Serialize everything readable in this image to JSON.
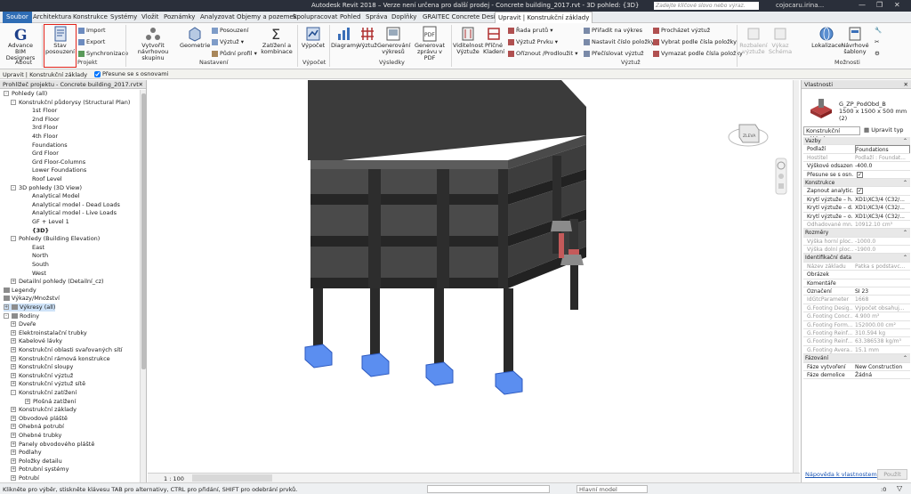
{
  "app": {
    "title": "Autodesk Revit 2018 – Verze není určena pro další prodej -  Concrete building_2017.rvt - 3D pohled: {3D}",
    "search_placeholder": "Zadejte klíčové slovo nebo výraz.",
    "user": "cojocaru.irina..."
  },
  "menu_tabs": [
    "Soubor",
    "Architektura",
    "Konstrukce",
    "Systémy",
    "Vložit",
    "Poznámky",
    "Analyzovat",
    "Objemy a pozemek",
    "Spolupracovat",
    "Pohled",
    "Správa",
    "Doplňky",
    "GRAITEC Concrete Design",
    "Upravit | Konstrukční základy"
  ],
  "ribbon": {
    "about_btn": "Advance BIM Designers",
    "stav_btn": "Stav posouzení",
    "project_small": [
      "Import",
      "Export",
      "Synchronizace"
    ],
    "vytvorit_btn": "Vytvořit návrhovou skupinu",
    "geometrie_btn": "Geometrie",
    "nastaveni_small": [
      "Posouzení",
      "Výztuž",
      "Půdní profil"
    ],
    "zatizeni_btn": "Zatížení a kombinace",
    "vypocet_btn": "Výpočet",
    "vysledky_btns": [
      "Diagramy",
      "Výztuž",
      "Generování výkresů",
      "Generovat zprávu v PDF"
    ],
    "vyztuz_btns": [
      "Viditelnost Výztuže",
      "Příčné Kladení"
    ],
    "vyztuz_small1": [
      "Řada prutů",
      "Výztuž Prvku",
      "Oříznout /Prodloužit"
    ],
    "vyztuz_small2": [
      "Přiřadit na výkres",
      "Nastavit číslo položky",
      "Přečíslovat výztuž"
    ],
    "vyztuz_small3": [
      "Procházet výztuž",
      "Vybrat podle čísla položky",
      "Vymazat podle čísla položky"
    ],
    "moznosti_btns": [
      "Rozbalení výztuže",
      "Výkaz Schéma",
      "Lokalizace",
      "Návrhové šablony"
    ],
    "groups": [
      "About",
      "Projekt",
      "Nastavení",
      "Výpočet",
      "Výsledky",
      "Výztuž",
      "Možnosti"
    ]
  },
  "options_bar": {
    "context": "Upravit | Konstrukční základy",
    "checkbox_label": "Přesune se s osnovami",
    "checked": true
  },
  "browser": {
    "title": "Prohlížeč projektu - Concrete building_2017.rvt",
    "items": [
      {
        "t": "Pohledy (all)",
        "lvl": 0,
        "tg": "-"
      },
      {
        "t": "Konstrukční půdorysy (Structural Plan)",
        "lvl": 1,
        "tg": "-"
      },
      {
        "t": "1st Floor",
        "lvl": 3
      },
      {
        "t": "2nd Floor",
        "lvl": 3
      },
      {
        "t": "3rd Floor",
        "lvl": 3
      },
      {
        "t": "4th Floor",
        "lvl": 3
      },
      {
        "t": "Foundations",
        "lvl": 3
      },
      {
        "t": "Grd Floor",
        "lvl": 3
      },
      {
        "t": "Grd Floor-Columns",
        "lvl": 3
      },
      {
        "t": "Lower Foundations",
        "lvl": 3
      },
      {
        "t": "Roof Level",
        "lvl": 3
      },
      {
        "t": "3D pohledy (3D View)",
        "lvl": 1,
        "tg": "-"
      },
      {
        "t": "Analytical Model",
        "lvl": 3
      },
      {
        "t": "Analytical model - Dead Loads",
        "lvl": 3
      },
      {
        "t": "Analytical model - Live Loads",
        "lvl": 3
      },
      {
        "t": "GF + Level 1",
        "lvl": 3
      },
      {
        "t": "{3D}",
        "lvl": 3,
        "bold": true
      },
      {
        "t": "Pohledy (Building Elevation)",
        "lvl": 1,
        "tg": "-"
      },
      {
        "t": "East",
        "lvl": 3
      },
      {
        "t": "North",
        "lvl": 3
      },
      {
        "t": "South",
        "lvl": 3
      },
      {
        "t": "West",
        "lvl": 3
      },
      {
        "t": "Detailní pohledy (Detailní_cz)",
        "lvl": 1,
        "tg": "+"
      },
      {
        "t": "Legendy",
        "lvl": 0,
        "icon": true
      },
      {
        "t": "Výkazy/Množství",
        "lvl": 0,
        "icon": true
      },
      {
        "t": "Výkresy (all)",
        "lvl": 0,
        "tg": "+",
        "icon": true,
        "sel": true
      },
      {
        "t": "Rodiny",
        "lvl": 0,
        "tg": "-",
        "icon": true
      },
      {
        "t": "Dveře",
        "lvl": 1,
        "tg": "+"
      },
      {
        "t": "Elektroinstalační trubky",
        "lvl": 1,
        "tg": "+"
      },
      {
        "t": "Kabelové lávky",
        "lvl": 1,
        "tg": "+"
      },
      {
        "t": "Konstrukční oblasti svařovaných sítí",
        "lvl": 1,
        "tg": "+"
      },
      {
        "t": "Konstrukční rámová konstrukce",
        "lvl": 1,
        "tg": "+"
      },
      {
        "t": "Konstrukční sloupy",
        "lvl": 1,
        "tg": "+"
      },
      {
        "t": "Konstrukční výztuž",
        "lvl": 1,
        "tg": "+"
      },
      {
        "t": "Konstrukční výztuž sítě",
        "lvl": 1,
        "tg": "+"
      },
      {
        "t": "Konstrukční zatížení",
        "lvl": 1,
        "tg": "-"
      },
      {
        "t": "Plošná zatížení",
        "lvl": 2,
        "tg": "+"
      },
      {
        "t": "Konstrukční základy",
        "lvl": 1,
        "tg": "+"
      },
      {
        "t": "Obvodové pláště",
        "lvl": 1,
        "tg": "+"
      },
      {
        "t": "Ohebná potrubí",
        "lvl": 1,
        "tg": "+"
      },
      {
        "t": "Ohebné trubky",
        "lvl": 1,
        "tg": "+"
      },
      {
        "t": "Panely obvodového pláště",
        "lvl": 1,
        "tg": "+"
      },
      {
        "t": "Podlahy",
        "lvl": 1,
        "tg": "+"
      },
      {
        "t": "Položky detailu",
        "lvl": 1,
        "tg": "+"
      },
      {
        "t": "Potrubní systémy",
        "lvl": 1,
        "tg": "+"
      },
      {
        "t": "Potrubí",
        "lvl": 1,
        "tg": "+"
      }
    ]
  },
  "viewport": {
    "scale": "1 : 100",
    "viewcube_label": "ZLEVA"
  },
  "props": {
    "title": "Vlastnosti",
    "type_name": "G_ZP_PodObd_B",
    "type_size": "1500 x 1500 x 500 mm (2)",
    "selector": "Konstrukční základy",
    "edit_type": "Upravit typ",
    "rows": [
      {
        "sec": "Vazby"
      },
      {
        "k": "Podlaží",
        "v": "Foundations"
      },
      {
        "k": "Hostitel",
        "v": "Podlaží : Foundat...",
        "dim": true
      },
      {
        "k": "Výškové odsazen...",
        "v": "-400.0"
      },
      {
        "k": "Přesune se s osn...",
        "chk": true
      },
      {
        "sec": "Konstrukce"
      },
      {
        "k": "Zapnout analytic...",
        "chk": true
      },
      {
        "k": "Krytí výztuže – h...",
        "v": "XD1\\XC3/4 (C32/..."
      },
      {
        "k": "Krytí výztuže – d...",
        "v": "XD1\\XC3/4 (C32/..."
      },
      {
        "k": "Krytí výztuže – o...",
        "v": "XD1\\XC3/4 (C32/..."
      },
      {
        "k": "Odhadované mn...",
        "v": "10912.10 cm³",
        "dim": true
      },
      {
        "sec": "Rozměry"
      },
      {
        "k": "Výška horní ploc...",
        "v": "-1000.0",
        "dim": true
      },
      {
        "k": "Výška dolní ploc...",
        "v": "-1900.0",
        "dim": true
      },
      {
        "sec": "Identifikační data"
      },
      {
        "k": "Název základu",
        "v": "Patka s podstavc...",
        "dim": true
      },
      {
        "k": "Obrázek",
        "v": ""
      },
      {
        "k": "Komentáře",
        "v": ""
      },
      {
        "k": "Označení",
        "v": "SI 23"
      },
      {
        "k": "IdGtcParameter",
        "v": "1668",
        "dim": true
      },
      {
        "k": "G.Footing Desig...",
        "v": "Výpočet obsahuj...",
        "dim": true
      },
      {
        "k": "G.Footing Concr...",
        "v": "4.900 m³",
        "dim": true
      },
      {
        "k": "G.Footing Form...",
        "v": "152000.00 cm²",
        "dim": true
      },
      {
        "k": "G.Footing Reinf...",
        "v": "310.594 kg",
        "dim": true
      },
      {
        "k": "G.Footing Reinf...",
        "v": "63.386538 kg/m³",
        "dim": true
      },
      {
        "k": "G.Footing Avera...",
        "v": "15.1 mm",
        "dim": true
      },
      {
        "sec": "Fázování"
      },
      {
        "k": "Fáze vytvoření",
        "v": "New Construction"
      },
      {
        "k": "Fáze demolice",
        "v": "Žádná"
      }
    ],
    "help_link": "Nápověda k vlastnostem",
    "apply": "Použít"
  },
  "status": {
    "text": "Klikněte pro výběr, stiskněte klávesu TAB pro alternativy, CTRL pro přidání, SHIFT pro odebrání prvků.",
    "model": "Hlavní model",
    "counter": ":0"
  },
  "colors": {
    "footing_selected": "#5b8ef0",
    "concrete": "#3c3c3c",
    "column": "#2a2a2a",
    "pier_red": "#c45a5a",
    "highlight": "#e2231a"
  }
}
